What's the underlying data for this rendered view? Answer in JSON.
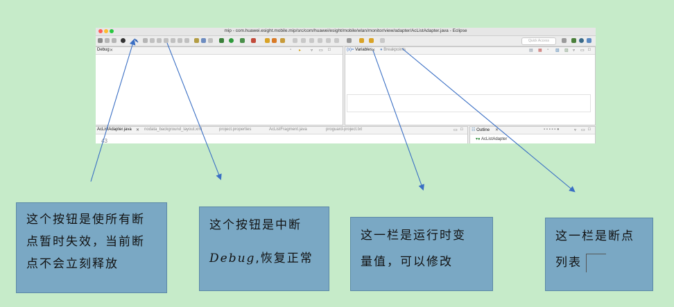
{
  "window": {
    "title": "mip - com.huawei.esight.mobile.mip/src/com/huawei/esight/mobile/wlan/monitor/view/adapter/AcListAdapter.java - Eclipse",
    "quick_access": "Quick Access"
  },
  "debug_view": {
    "tab_label": "Debug"
  },
  "variables_view": {
    "variables_tab": "Variables",
    "breakpoints_tab": "Breakpoints"
  },
  "editor": {
    "tabs": [
      "AcListAdapter.java",
      "nodata_background_layout.xml",
      "project.properties",
      "AcListFragment.java",
      "proguard-project.txt"
    ],
    "line_number": "43"
  },
  "outline": {
    "tab_label": "Outline",
    "item": "AcListAdapter"
  },
  "annotations": {
    "skip_all": {
      "line1": "这个按钮是使所有断",
      "line2": "点暂时失效，当前断",
      "line3": "点不会立刻释放"
    },
    "resume": {
      "line1": "这个按钮是中断",
      "line2_code": "Debug",
      "line2_rest": ",恢复正常"
    },
    "variables": {
      "line1": "这一栏是运行时变",
      "line2": "量值，可以修改"
    },
    "breakpoints": {
      "line1": "这一栏是断点",
      "line2": "列表"
    }
  },
  "colors": {
    "background": "#c6ebc9",
    "note_fill": "#7aa8c4",
    "arrow": "#3a6fc4"
  }
}
